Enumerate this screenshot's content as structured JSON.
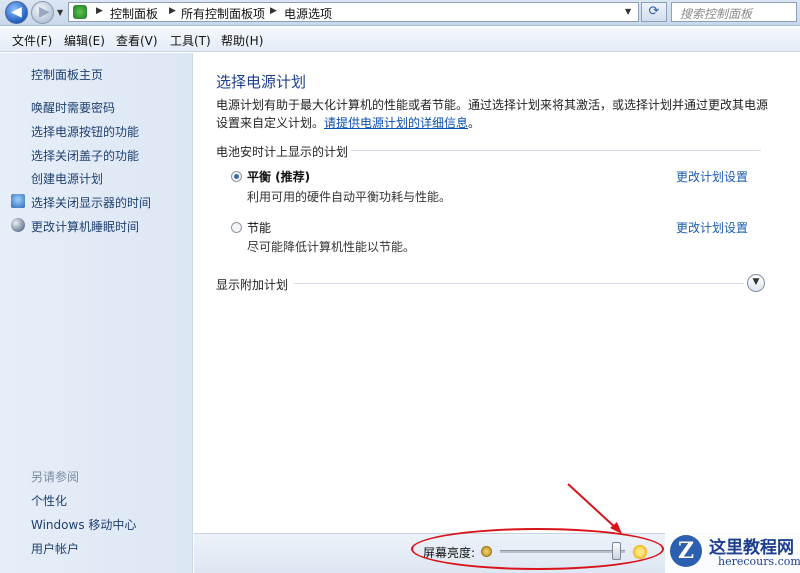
{
  "address_bar": {
    "path": [
      "控制面板",
      "所有控制面板项",
      "电源选项"
    ],
    "search_placeholder": "搜索控制面板"
  },
  "menu": [
    "文件(F)",
    "编辑(E)",
    "查看(V)",
    "工具(T)",
    "帮助(H)"
  ],
  "sidebar": {
    "home": "控制面板主页",
    "links": [
      "唤醒时需要密码",
      "选择电源按钮的功能",
      "选择关闭盖子的功能",
      "创建电源计划",
      "选择关闭显示器的时间",
      "更改计算机睡眠时间"
    ],
    "see_also_heading": "另请参阅",
    "see_also": [
      "个性化",
      "Windows 移动中心",
      "用户帐户"
    ]
  },
  "main": {
    "title": "选择电源计划",
    "description": "电源计划有助于最大化计算机的性能或者节能。通过选择计划来将其激活，或选择计划并通过更改其电源设置来自定义计划。",
    "details_link": "请提供电源计划的详细信息",
    "group_header": "电池安时计上显示的计划",
    "plans": [
      {
        "name": "平衡 (推荐)",
        "desc": "利用可用的硬件自动平衡功耗与性能。",
        "selected": true
      },
      {
        "name": "节能",
        "desc": "尽可能降低计算机性能以节能。",
        "selected": false
      }
    ],
    "change_settings": "更改计划设置",
    "additional_plans": "显示附加计划"
  },
  "brightness": {
    "label": "屏幕亮度:",
    "level": 0.93
  },
  "watermark": {
    "logo": "Z",
    "title": "这里教程网",
    "domain": "herecours.com"
  },
  "colors": {
    "annotation": "#d8141a",
    "link": "#1a5cb0",
    "title": "#1e3f8f"
  }
}
